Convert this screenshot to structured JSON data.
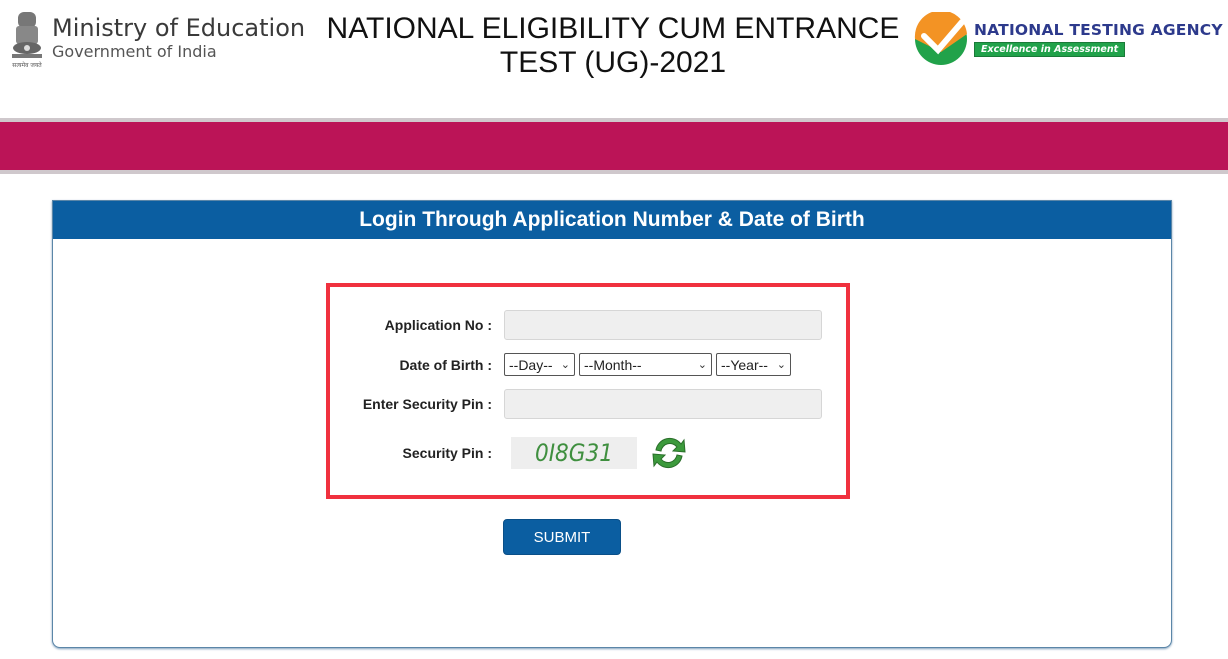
{
  "header": {
    "ministry_title": "Ministry of Education",
    "ministry_subtitle": "Government of India",
    "emblem_caption": "सत्यमेव जयते",
    "exam_title_line1": "NATIONAL ELIGIBILITY CUM ENTRANCE",
    "exam_title_line2": "TEST (UG)-2021",
    "agency_name": "NATIONAL TESTING AGENCY",
    "agency_tagline": "Excellence in Assessment"
  },
  "colors": {
    "band": "#bb1457",
    "panel_header": "#0b5ea1",
    "highlight_border": "#f0313e",
    "submit": "#0b5ea1"
  },
  "login": {
    "title": "Login Through Application Number & Date of Birth",
    "fields": {
      "application_no_label": "Application No :",
      "application_no_value": "",
      "dob_label": "Date of Birth :",
      "day_selected": "--Day--",
      "month_selected": "--Month--",
      "year_selected": "--Year--",
      "security_pin_input_label": "Enter Security Pin :",
      "security_pin_input_value": "",
      "security_pin_label": "Security Pin :",
      "captcha_text": "0I8G31"
    },
    "icons": {
      "refresh": "refresh-icon",
      "dropdown": "chevron-down-icon"
    },
    "submit_label": "SUBMIT"
  }
}
